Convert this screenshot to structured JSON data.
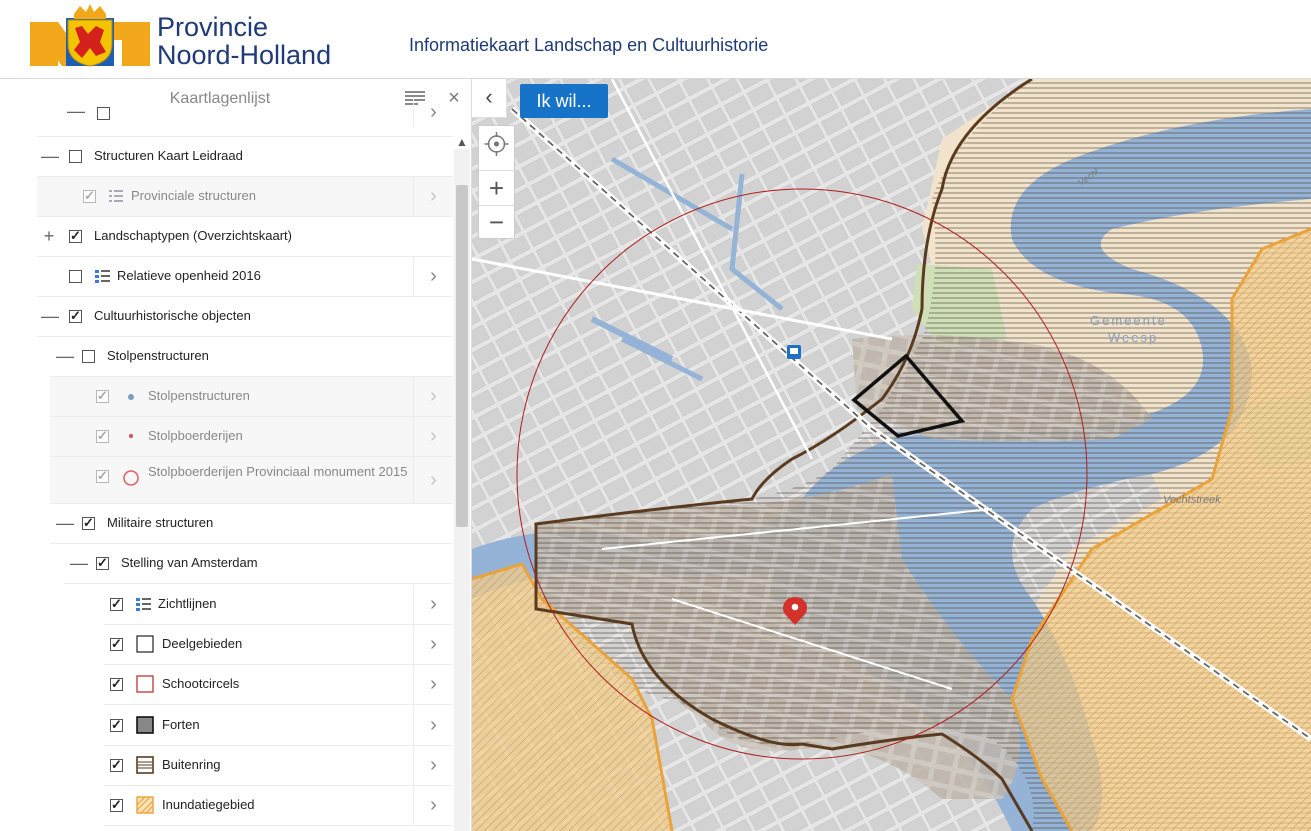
{
  "header": {
    "brand_line1": "Provincie",
    "brand_line2": "Noord-Holland",
    "subtitle": "Informatiekaart Landschap en Cultuurhistorie"
  },
  "sidebar": {
    "title": "Kaartlagenlijst",
    "close": "×",
    "layers": [
      {
        "label": "Structuren Kaart Leidraad",
        "toggle": "—",
        "checked": false
      },
      {
        "label": "Provinciale structuren",
        "checked": true,
        "dim": true
      },
      {
        "label": "Landschaptypen (Overzichtskaart)",
        "toggle": "+",
        "checked": true
      },
      {
        "label": "Relatieve openheid 2016",
        "checked": false
      },
      {
        "label": "Cultuurhistorische objecten",
        "toggle": "—",
        "checked": true
      },
      {
        "label": "Stolpenstructuren",
        "toggle": "—",
        "checked": false
      },
      {
        "label": "Stolpenstructuren",
        "checked": true,
        "dim": true
      },
      {
        "label": "Stolpboerderijen",
        "checked": true,
        "dim": true
      },
      {
        "label": "Stolpboerderijen Provinciaal monument 2015",
        "checked": true,
        "dim": true
      },
      {
        "label": "Militaire structuren",
        "toggle": "—",
        "checked": true
      },
      {
        "label": "Stelling van Amsterdam",
        "toggle": "—",
        "checked": true
      },
      {
        "label": "Zichtlijnen",
        "checked": true
      },
      {
        "label": "Deelgebieden",
        "checked": true
      },
      {
        "label": "Schootcircels",
        "checked": true
      },
      {
        "label": "Forten",
        "checked": true
      },
      {
        "label": "Buitenring",
        "checked": true
      },
      {
        "label": "Inundatiegebied",
        "checked": true
      }
    ]
  },
  "map": {
    "ik_wil": "Ik wil...",
    "collapse": "‹",
    "zoom_in": "+",
    "zoom_out": "−",
    "label_gemeente": "Gemeente",
    "label_weesp": "Weesp",
    "label_vechtstreek": "Vechtstreek",
    "label_vecht": "Vecht"
  },
  "colors": {
    "brand_blue": "#1f3a78",
    "button_blue": "#1673c8",
    "water": "#94b3d6",
    "inundatie": "#e9a33a",
    "buitenring": "#5a3b1f"
  }
}
